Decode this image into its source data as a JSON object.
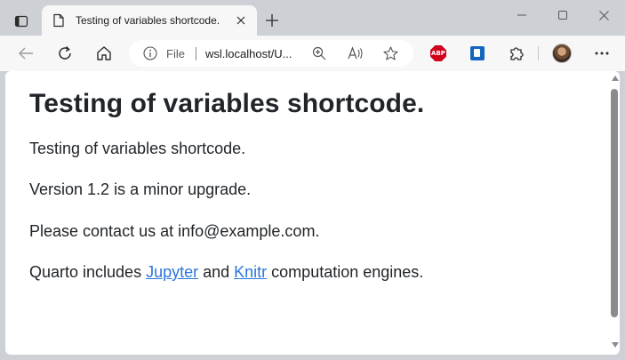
{
  "browser": {
    "tab": {
      "title": "Testing of variables shortcode."
    },
    "address_bar": {
      "scheme_label": "File",
      "url": "wsl.localhost/U..."
    }
  },
  "page": {
    "heading": "Testing of variables shortcode.",
    "paragraphs": {
      "p1": "Testing of variables shortcode.",
      "p2": "Version 1.2 is a minor upgrade.",
      "p3": "Please contact us at info@example.com.",
      "p4_before": "Quarto includes ",
      "p4_link1": "Jupyter",
      "p4_middle": " and ",
      "p4_link2": "Knitr",
      "p4_after": " computation engines."
    }
  },
  "icons": {
    "tab_actions": "tab-actions-icon",
    "page": "page-icon",
    "close_tab": "close-icon",
    "new_tab": "plus-icon",
    "minimize": "minimize-icon",
    "maximize": "maximize-icon",
    "close_window": "close-icon",
    "back": "back-arrow-icon",
    "refresh": "refresh-icon",
    "home": "home-icon",
    "info": "info-icon",
    "zoom": "zoom-icon",
    "read_aloud": "read-aloud-icon",
    "favorite": "star-icon",
    "adblock": "adblock-icon",
    "extension_blue": "extension-icon",
    "extensions": "puzzle-icon",
    "profile": "avatar",
    "more": "more-icon"
  },
  "colors": {
    "chrome_bg": "#cdd1d6",
    "toolbar_bg": "#f7f7f7",
    "link": "#2a76dd",
    "text": "#212529"
  }
}
